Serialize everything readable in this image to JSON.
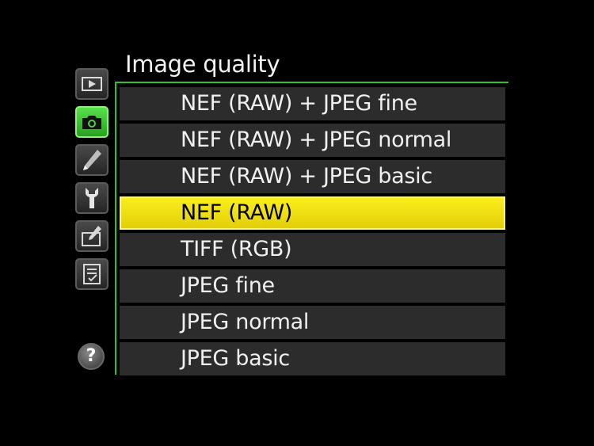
{
  "menu": {
    "title": "Image quality"
  },
  "tabs": [
    {
      "icon": "playback-icon",
      "active": false
    },
    {
      "icon": "camera-icon",
      "active": true
    },
    {
      "icon": "pencil-icon",
      "active": false
    },
    {
      "icon": "wrench-icon",
      "active": false
    },
    {
      "icon": "retouch-icon",
      "active": false
    },
    {
      "icon": "my-menu-icon",
      "active": false
    }
  ],
  "help": {
    "icon": "help-icon",
    "label": "?"
  },
  "options": [
    {
      "label": "NEF (RAW) + JPEG fine",
      "selected": false
    },
    {
      "label": "NEF (RAW) + JPEG normal",
      "selected": false
    },
    {
      "label": "NEF (RAW) + JPEG basic",
      "selected": false
    },
    {
      "label": "NEF (RAW)",
      "selected": true
    },
    {
      "label": "TIFF (RGB)",
      "selected": false
    },
    {
      "label": "JPEG fine",
      "selected": false
    },
    {
      "label": "JPEG normal",
      "selected": false
    },
    {
      "label": "JPEG basic",
      "selected": false
    }
  ],
  "colors": {
    "accent_green": "#2fc12a",
    "highlight_yellow": "#f2e313",
    "row_background": "#2c2c2c"
  }
}
